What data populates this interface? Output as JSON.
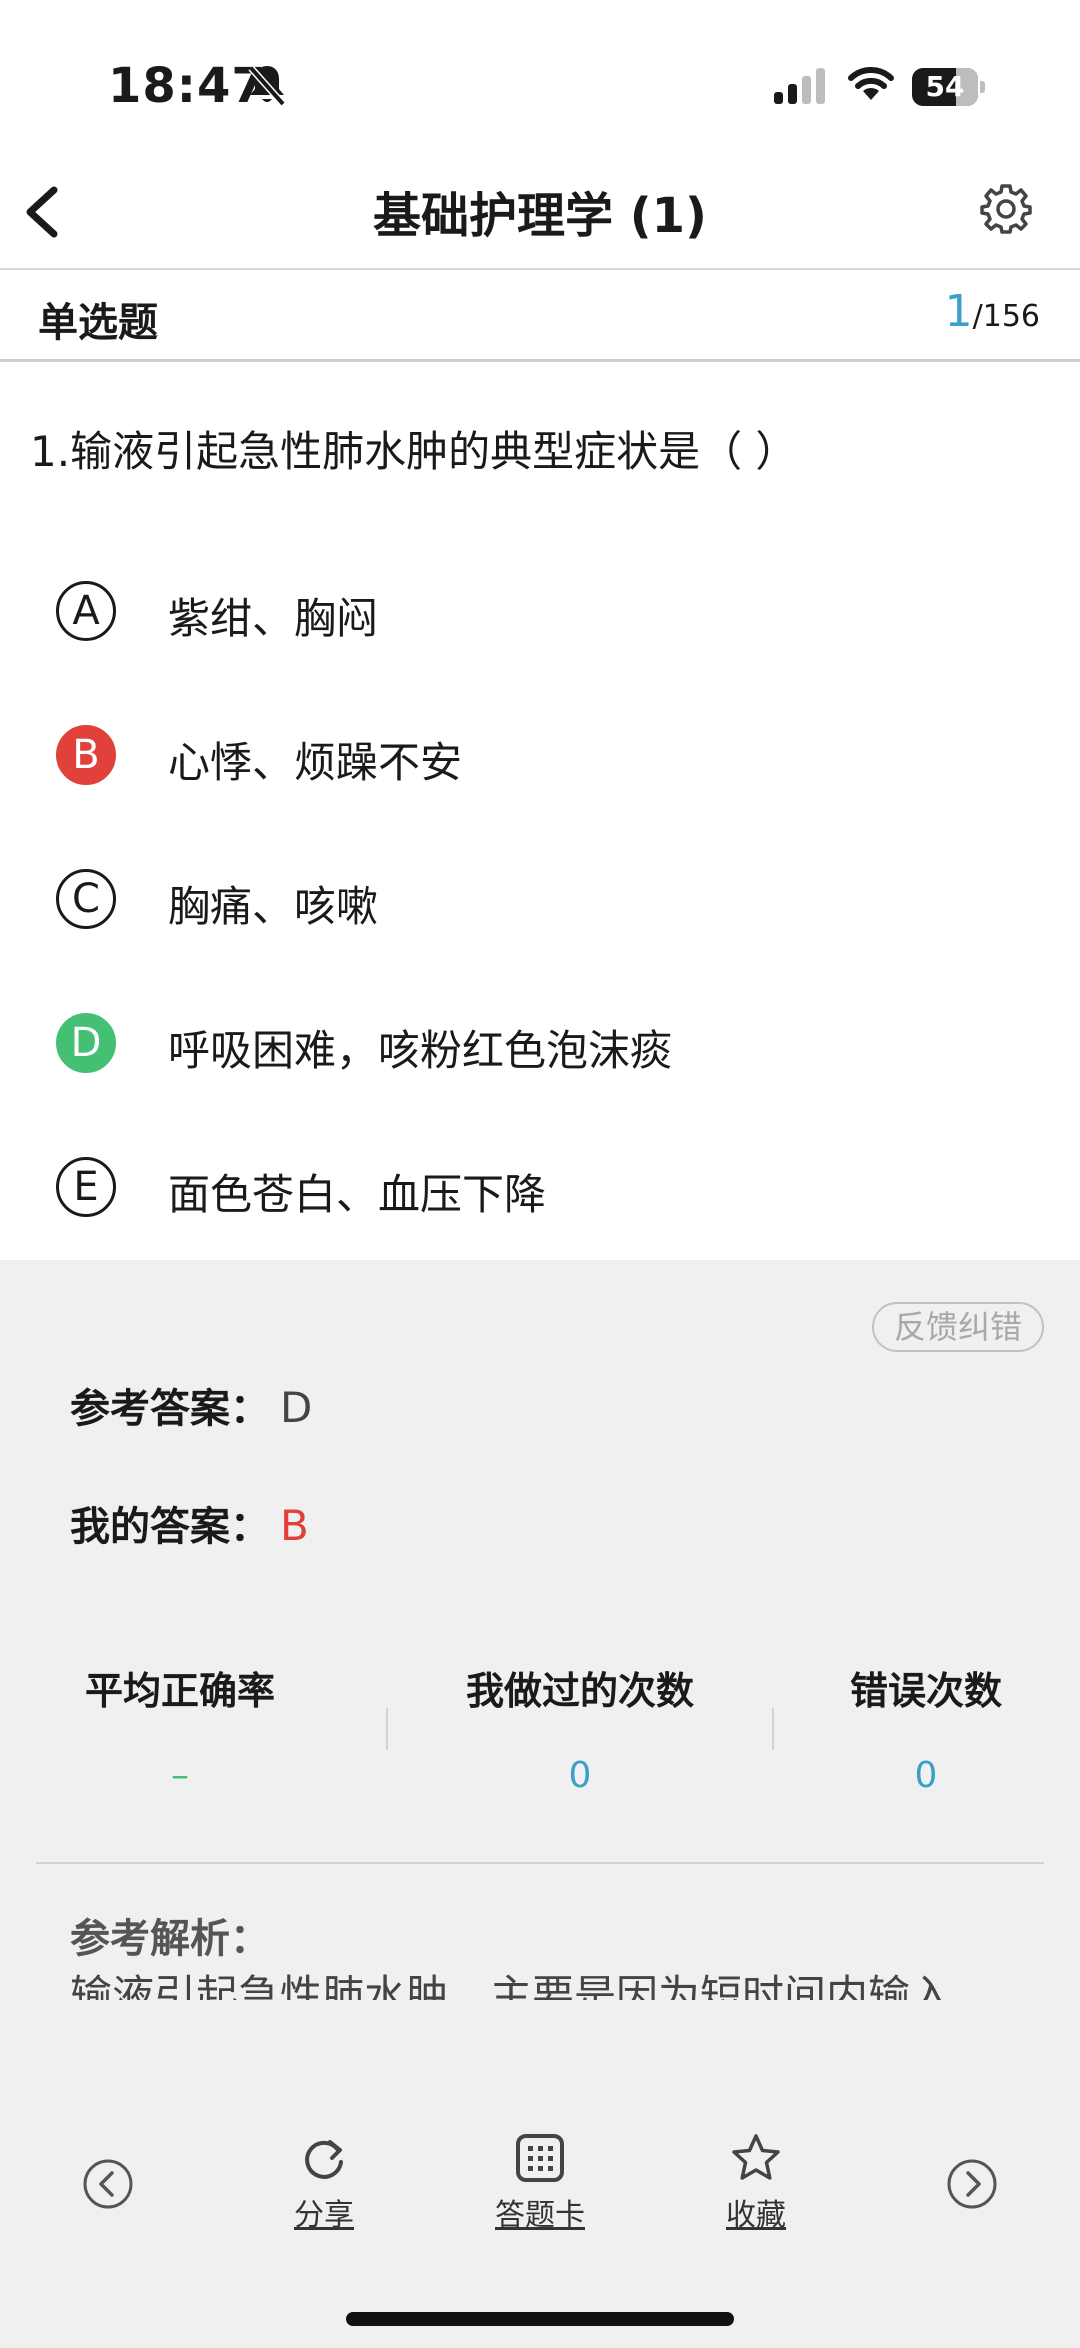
{
  "status_bar": {
    "time": "18:47",
    "battery": "54"
  },
  "navbar": {
    "title": "基础护理学 (1)"
  },
  "type_bar": {
    "type": "单选题",
    "current": "1",
    "total": "/156"
  },
  "question": {
    "text": "1.输液引起急性肺水肿的典型症状是（   ）",
    "options": [
      {
        "letter": "A",
        "text": "紫绀、胸闷",
        "state": "none"
      },
      {
        "letter": "B",
        "text": "心悸、烦躁不安",
        "state": "wrong"
      },
      {
        "letter": "C",
        "text": "胸痛、咳嗽",
        "state": "none"
      },
      {
        "letter": "D",
        "text": "呼吸困难，咳粉红色泡沫痰",
        "state": "correct"
      },
      {
        "letter": "E",
        "text": "面色苍白、血压下降",
        "state": "none"
      }
    ]
  },
  "answer": {
    "feedback_label": "反馈纠错",
    "reference_label": "参考答案：",
    "reference_value": "D",
    "mine_label": "我的答案：",
    "mine_value": "B"
  },
  "stats": [
    {
      "label": "平均正确率",
      "value": "–"
    },
    {
      "label": "我做过的次数",
      "value": "0"
    },
    {
      "label": "错误次数",
      "value": "0"
    }
  ],
  "analysis": {
    "title": "参考解析：",
    "text": "输液引起急性肺水肿，主要是因为短时间内输入"
  },
  "toolbar": {
    "share_label": "分享",
    "card_label": "答题卡",
    "favorite_label": "收藏"
  },
  "colors": {
    "wrong": "#e0413a",
    "correct": "#44c075",
    "accent": "#3aa0c8",
    "panel": "#f0f0f0"
  },
  "icons": [
    "bell-slash-icon",
    "cellular-signal-icon",
    "wifi-icon",
    "chevron-left-icon",
    "gear-icon",
    "share-icon",
    "grid-icon",
    "star-icon",
    "circle-chevron-left-icon",
    "circle-chevron-right-icon"
  ]
}
